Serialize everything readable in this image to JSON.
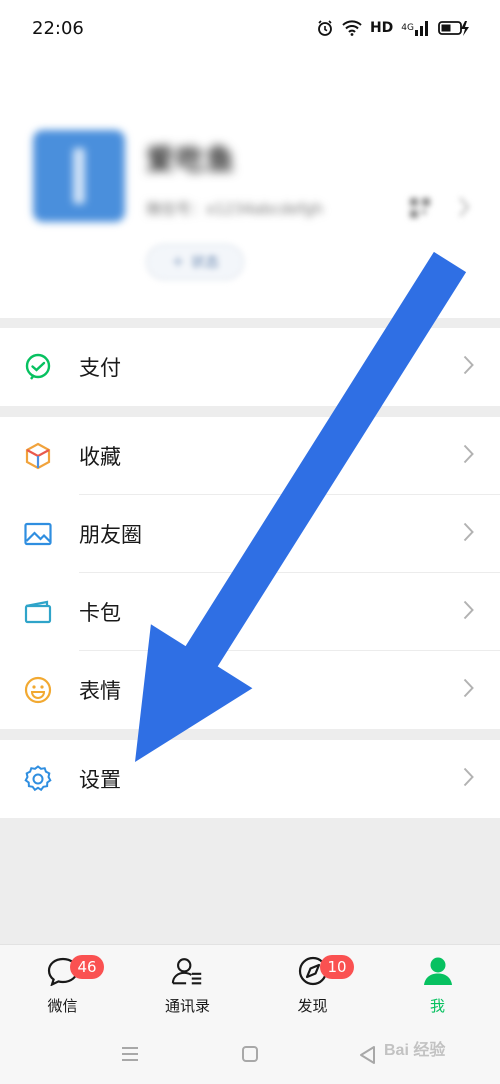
{
  "status_bar": {
    "time": "22:06",
    "hd": "HD",
    "network": "4G",
    "icons": [
      "alarm-icon",
      "wifi-icon",
      "signal-icon",
      "battery-charging-icon"
    ]
  },
  "profile": {
    "nickname": "爱吃鱼",
    "wechat_id": "微信号：x1234abcdefgh",
    "status_button": "状态"
  },
  "menu": {
    "group1": [
      {
        "label": "支付",
        "icon": "pay-icon"
      }
    ],
    "group2": [
      {
        "label": "收藏",
        "icon": "favorites-icon"
      },
      {
        "label": "朋友圈",
        "icon": "moments-icon"
      },
      {
        "label": "卡包",
        "icon": "card-wallet-icon"
      },
      {
        "label": "表情",
        "icon": "sticker-icon"
      }
    ],
    "group3": [
      {
        "label": "设置",
        "icon": "settings-icon"
      }
    ]
  },
  "tabs": [
    {
      "label": "微信",
      "badge": "46",
      "icon": "chat-bubble-icon",
      "active": false
    },
    {
      "label": "通讯录",
      "badge": "",
      "icon": "contacts-icon",
      "active": false
    },
    {
      "label": "发现",
      "badge": "10",
      "icon": "compass-icon",
      "active": false
    },
    {
      "label": "我",
      "badge": "",
      "icon": "person-icon",
      "active": true
    }
  ],
  "colors": {
    "accent_green": "#07c160",
    "badge_red": "#fa5151",
    "annotation_arrow": "#2f6fe4",
    "page_bg": "#ededed"
  },
  "watermark": "Bai 经验"
}
